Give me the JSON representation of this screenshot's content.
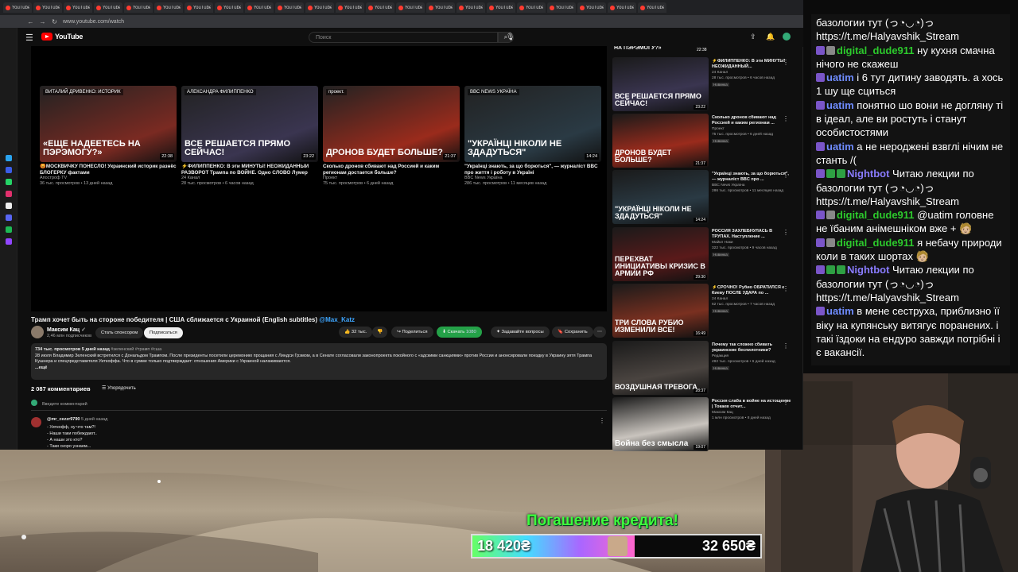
{
  "browser": {
    "url": "www.youtube.com/watch",
    "tabs": [
      "YouTube",
      "YouTube",
      "YouTube",
      "YouTube",
      "YouTube",
      "YouTube",
      "YouTube",
      "YouTube",
      "YouTube",
      "YouTube",
      "YouTube",
      "YouTube",
      "YouTube",
      "YouTube",
      "YouTube",
      "YouTube",
      "YouTube",
      "YouTube",
      "YouTube",
      "YouTube",
      "YouTube",
      "YouTube"
    ]
  },
  "youtube": {
    "logo_text": "YouTube",
    "search_placeholder": "Поиск",
    "endcards": [
      {
        "caption": "«ЕЩЕ НАДЕЕТЕСЬ НА ПЭРЭМОГУ?»",
        "tag": "ВИТАЛИЙ ДРИВЕНКО: ИСТОРИК",
        "duration": "22:38",
        "title": "😡МОСКВИЧКУ ПОНЕСЛО! Украинский историк разнёс БЛОГЕРКУ фактами",
        "channel": "Апостроф TV",
        "meta": "36 тыс. просмотров • 13 дней назад",
        "bg": "#7a2a22"
      },
      {
        "caption": "ВСЕ РЕШАЕТСЯ ПРЯМО СЕЙЧАС!",
        "tag": "АЛЕКСАНДРА ФИЛИППЕНКО",
        "duration": "23:22",
        "title": "⚡ФИЛИППЕНКО: В эти МИНУТЫ! НЕОЖИДАННЫЙ РАЗВОРОТ Трампа по ВОЙНЕ. Одно СЛОВО Лумер все...",
        "channel": "24 Канал",
        "meta": "28 тыс. просмотров • 6 часов назад",
        "bg": "#3a3550"
      },
      {
        "caption": "ДРОНОВ БУДЕТ БОЛЬШЕ?",
        "tag": "проект.",
        "duration": "21:37",
        "title": "Сколько дронов сбивают над Россией и каким регионам достается больше?",
        "channel": "Проект",
        "meta": "75 тыс. просмотров • 6 дней назад",
        "bg": "#9a2b1c"
      },
      {
        "caption": "\"УКРАЇНЦІ НІКОЛИ НЕ ЗДАДУТЬСЯ\"",
        "tag": "BBC NEWS УКРАЇНА",
        "duration": "14:24",
        "title": "\"Українці знають, за що борються\", — журналіст BBC про життя і роботу в Україні",
        "channel": "BBC News Україна",
        "meta": "286 тыс. просмотров • 11 месяцев назад",
        "bg": "#2a3a44"
      }
    ],
    "video": {
      "title": "Трамп хочет быть на стороне победителя | США сближается с Украиной (English subtitles)",
      "title_tag": "@Max_Katz",
      "channel": "Максим Кац",
      "subs": "2,46 млн подписчиков",
      "sponsor": "Стать спонсором",
      "subscribe": "Подписаться",
      "likes": "32 тыс.",
      "share": "Поделиться",
      "download": "Скачать",
      "quality": "1080",
      "ask": "Задавайте вопросы",
      "save": "Сохранить",
      "desc_stats": "734 тыс. просмотров  5 дней назад",
      "desc_tags": "#зеленский #трамп #сша",
      "desc_text": "28 июля Владимир Зеленский встретился с Дональдом Трампом. После президенты посетили церемонию прощания с Линдси Грэмом, а в Сенате согласовали законопроекта покойного с «адскими санкциями» против России и анонсировали поездку в Украину зятя Трампа Кушнера и спецпредставителя Уиткоффа. Что в сумме только подтверждает: отношения Америки с Украиной налаживаются.",
      "desc_more": "...ещё"
    },
    "comments": {
      "count": "2 087 комментариев",
      "sort": "Упорядочить",
      "add": "Введите комментарий",
      "first": {
        "author": "@mr_cezzr9790",
        "time": "5 дней назад",
        "lines": [
          "- Уиткофф, ну что там?!",
          "- Наши таки побеждают..",
          "- А наши это кто?",
          "- Таки скоро узнаем..."
        ]
      }
    },
    "recs": [
      {
        "title": "НА ПЭРЭМОГУ?»",
        "caption": "",
        "duration": "22:38",
        "channel": "",
        "meta": "",
        "badge": "",
        "bg": "#6a2a22"
      },
      {
        "title": "⚡ФИЛИППЕНКО: В эти МИНУТЫ! НЕОЖИДАННЫЙ...",
        "caption": "ВСЕ РЕШАЕТСЯ ПРЯМО СЕЙЧАС!",
        "duration": "23:22",
        "channel": "24 Канал",
        "meta": "28 тыс. просмотров • 6 часов назад",
        "badge": "Новинка",
        "bg": "#3a3550"
      },
      {
        "title": "Сколько дронов сбивают над Россией и каким регионам ...",
        "caption": "ДРОНОВ БУДЕТ БОЛЬШЕ?",
        "duration": "21:37",
        "channel": "Проект",
        "meta": "75 тыс. просмотров • 6 дней назад",
        "badge": "Новинка",
        "bg": "#9a2b1c"
      },
      {
        "title": "\"Українці знають, за що борються\", — журналіст BBC про ...",
        "caption": "\"УКРАЇНЦІ НІКОЛИ НЕ ЗДАДУТЬСЯ\"",
        "duration": "14:24",
        "channel": "BBC News Україна",
        "meta": "286 тыс. просмотров • 11 месяцев назад",
        "badge": "",
        "bg": "#2a3a44"
      },
      {
        "title": "РОССИЯ ЗАХЛЕБНУЛАСЬ В ТРУПАХ. Наступление ...",
        "caption": "ПЕРЕХВАТ ИНИЦИАТИВЫ КРИЗИС В АРМИИ РФ",
        "duration": "29:30",
        "channel": "Майкл Наки",
        "meta": "322 тыс. просмотров • 9 часов назад",
        "badge": "Новинка",
        "bg": "#5a1a1a"
      },
      {
        "title": "⚡СРОЧНО! Рубио ОБРАТИЛСЯ к Киеву ПОСЛЕ УДАРА по ...",
        "caption": "ТРИ СЛОВА РУБИО ИЗМЕНИЛИ ВСЕ!",
        "duration": "16:49",
        "channel": "24 Канал",
        "meta": "62 тыс. просмотров • 7 часов назад",
        "badge": "Новинка",
        "bg": "#7a3020"
      },
      {
        "title": "Почему так сложно сбивать украинские беспилотники?",
        "caption": "ВОЗДУШНАЯ ТРЕВОГА",
        "duration": "28:37",
        "channel": "Редакция",
        "meta": "492 тыс. просмотров • 6 дней назад",
        "badge": "Новинка",
        "bg": "#4a4440"
      },
      {
        "title": "Россия слаба в войне на истощение | Токаев отчит...",
        "caption": "Война без смысла",
        "duration": "19:07",
        "channel": "Максим Кац",
        "meta": "1 млн просмотров • 8 дней назад",
        "badge": "",
        "bg": "#c9c4be"
      }
    ]
  },
  "chat": {
    "messages": [
      {
        "user": "",
        "color": "#fff",
        "badges": [],
        "text": "базологии тут (っ◔◡◔)っ https://t.me/Halyavshik_Stream"
      },
      {
        "user": "digital_dude911",
        "color": "#2cc92c",
        "badges": [
          "#7a55c8",
          "#888"
        ],
        "text": "ну кухня смачна нічого не скажеш"
      },
      {
        "user": "uatim",
        "color": "#6f8cff",
        "badges": [
          "#7a55c8"
        ],
        "text": "і 6 тут дитину заводять. а хось 1 шу ще сциться"
      },
      {
        "user": "uatim",
        "color": "#6f8cff",
        "badges": [
          "#7a55c8"
        ],
        "text": "понятно шо вони не догляну ті в ідеал, але ви ростуть і станут особистостями"
      },
      {
        "user": "uatim",
        "color": "#6f8cff",
        "badges": [
          "#7a55c8"
        ],
        "text": "а не нероджені взвглі нічим не станть /("
      },
      {
        "user": "Nightbot",
        "color": "#8a7cff",
        "badges": [
          "#7a55c8",
          "#2ea043",
          "#2ea043"
        ],
        "text": "Читаю лекции по базологии тут (っ◔◡◔)っ https://t.me/Halyavshik_Stream"
      },
      {
        "user": "digital_dude911",
        "color": "#2cc92c",
        "badges": [
          "#7a55c8",
          "#888"
        ],
        "text": "@uatim головне не їбаним анімешніком вже + 🧑🏼"
      },
      {
        "user": "digital_dude911",
        "color": "#2cc92c",
        "badges": [
          "#7a55c8",
          "#888"
        ],
        "text": "я небачу природи коли в таких шортах 🧑🏼"
      },
      {
        "user": "Nightbot",
        "color": "#8a7cff",
        "badges": [
          "#7a55c8",
          "#2ea043",
          "#2ea043"
        ],
        "text": "Читаю лекции по базологии тут (っ◔◡◔)っ https://t.me/Halyavshik_Stream"
      },
      {
        "user": "uatim",
        "color": "#6f8cff",
        "badges": [
          "#7a55c8"
        ],
        "text": "в мене сеструха, приблизно її віку на купянську витягує поранених. і такі їздоки на ендуро завжди потрібні і є вакансії."
      }
    ]
  },
  "goal": {
    "title": "Погашение кредита!",
    "current": "18 420₴",
    "target": "32 650₴",
    "progress": 0.564
  }
}
